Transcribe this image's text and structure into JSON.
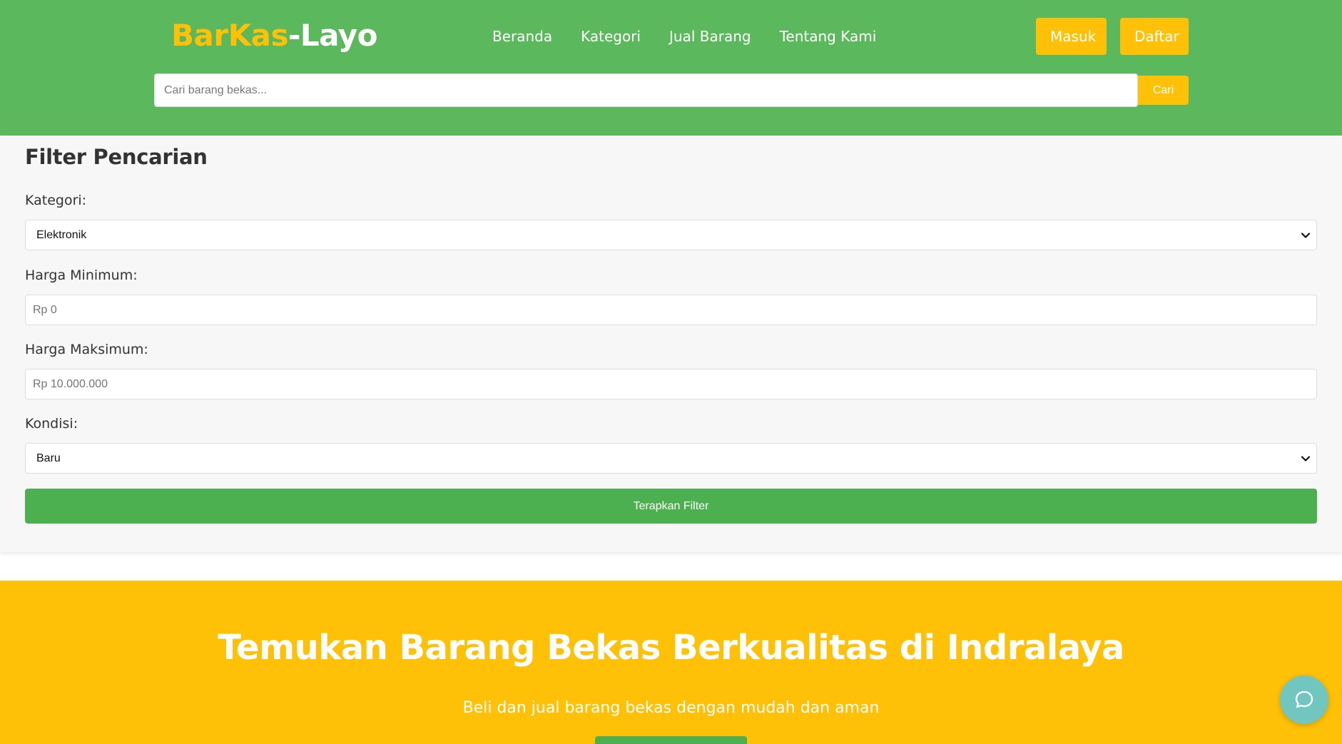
{
  "header": {
    "logo_part1": "BarKas",
    "logo_part2": "-Layo",
    "nav": [
      "Beranda",
      "Kategori",
      "Jual Barang",
      "Tentang Kami"
    ],
    "login_label": "Masuk",
    "register_label": "Daftar",
    "search_placeholder": "Cari barang bekas...",
    "search_button": "Cari"
  },
  "filter": {
    "title": "Filter Pencarian",
    "category_label": "Kategori:",
    "category_value": "Elektronik",
    "min_price_label": "Harga Minimum:",
    "min_price_placeholder": "Rp 0",
    "max_price_label": "Harga Maksimum:",
    "max_price_placeholder": "Rp 10.000.000",
    "condition_label": "Kondisi:",
    "condition_value": "Baru",
    "apply_button": "Terapkan Filter"
  },
  "hero": {
    "title": "Temukan Barang Bekas Berkualitas di Indralaya",
    "subtitle": "Beli dan jual barang bekas dengan mudah dan aman"
  },
  "icons": {
    "chat": "chat-bubble-icon",
    "dropdown": "chevron-down-icon"
  },
  "colors": {
    "header_green": "#5cb85c",
    "accent_yellow": "#ffc107",
    "button_green": "#4caf50",
    "chat_teal": "#72c6c0"
  }
}
